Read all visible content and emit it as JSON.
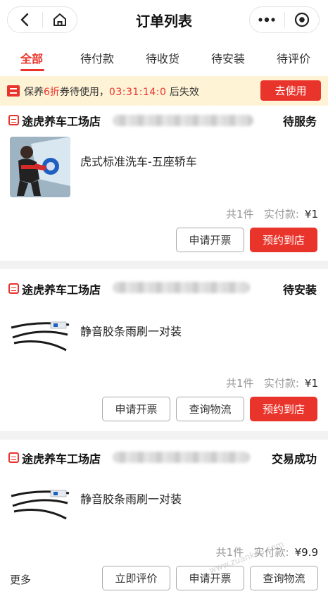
{
  "header": {
    "title": "订单列表",
    "back_icon": "back-arrow-icon",
    "home_icon": "home-icon",
    "more_icon": "more-dots-icon",
    "close_icon": "target-circle-icon"
  },
  "tabs": [
    {
      "label": "全部",
      "active": true
    },
    {
      "label": "待付款",
      "active": false
    },
    {
      "label": "待收货",
      "active": false
    },
    {
      "label": "待安装",
      "active": false
    },
    {
      "label": "待评价",
      "active": false
    }
  ],
  "promo": {
    "text_prefix": "保养",
    "discount": "6折",
    "text_middle": "券待使用，",
    "timer": "03:31:14:0",
    "text_suffix": " 后失效",
    "button_label": "去使用",
    "accent": "#e9342b",
    "background": "#fff3d6"
  },
  "orders": [
    {
      "shop_name": "途虎养车工场店",
      "status": "待服务",
      "product_name": "虎式标准洗车-五座轿车",
      "count_text": "共1件",
      "paid_label": "实付款:",
      "paid_amount": "¥1",
      "buttons": [
        "申请开票",
        "预约到店"
      ]
    },
    {
      "shop_name": "途虎养车工场店",
      "status": "待安装",
      "product_name": "静音胶条雨刷一对装",
      "count_text": "共1件",
      "paid_label": "实付款:",
      "paid_amount": "¥1",
      "buttons": [
        "申请开票",
        "查询物流",
        "预约到店"
      ]
    },
    {
      "shop_name": "途虎养车工场店",
      "status": "交易成功",
      "product_name": "静音胶条雨刷一对装",
      "count_text": "共1件",
      "paid_label": "实付款:",
      "paid_amount": "¥9.9",
      "more_label": "更多",
      "buttons": [
        "立即评价",
        "申请开票",
        "查询物流"
      ]
    }
  ],
  "watermark": "www.zuanke8.com"
}
